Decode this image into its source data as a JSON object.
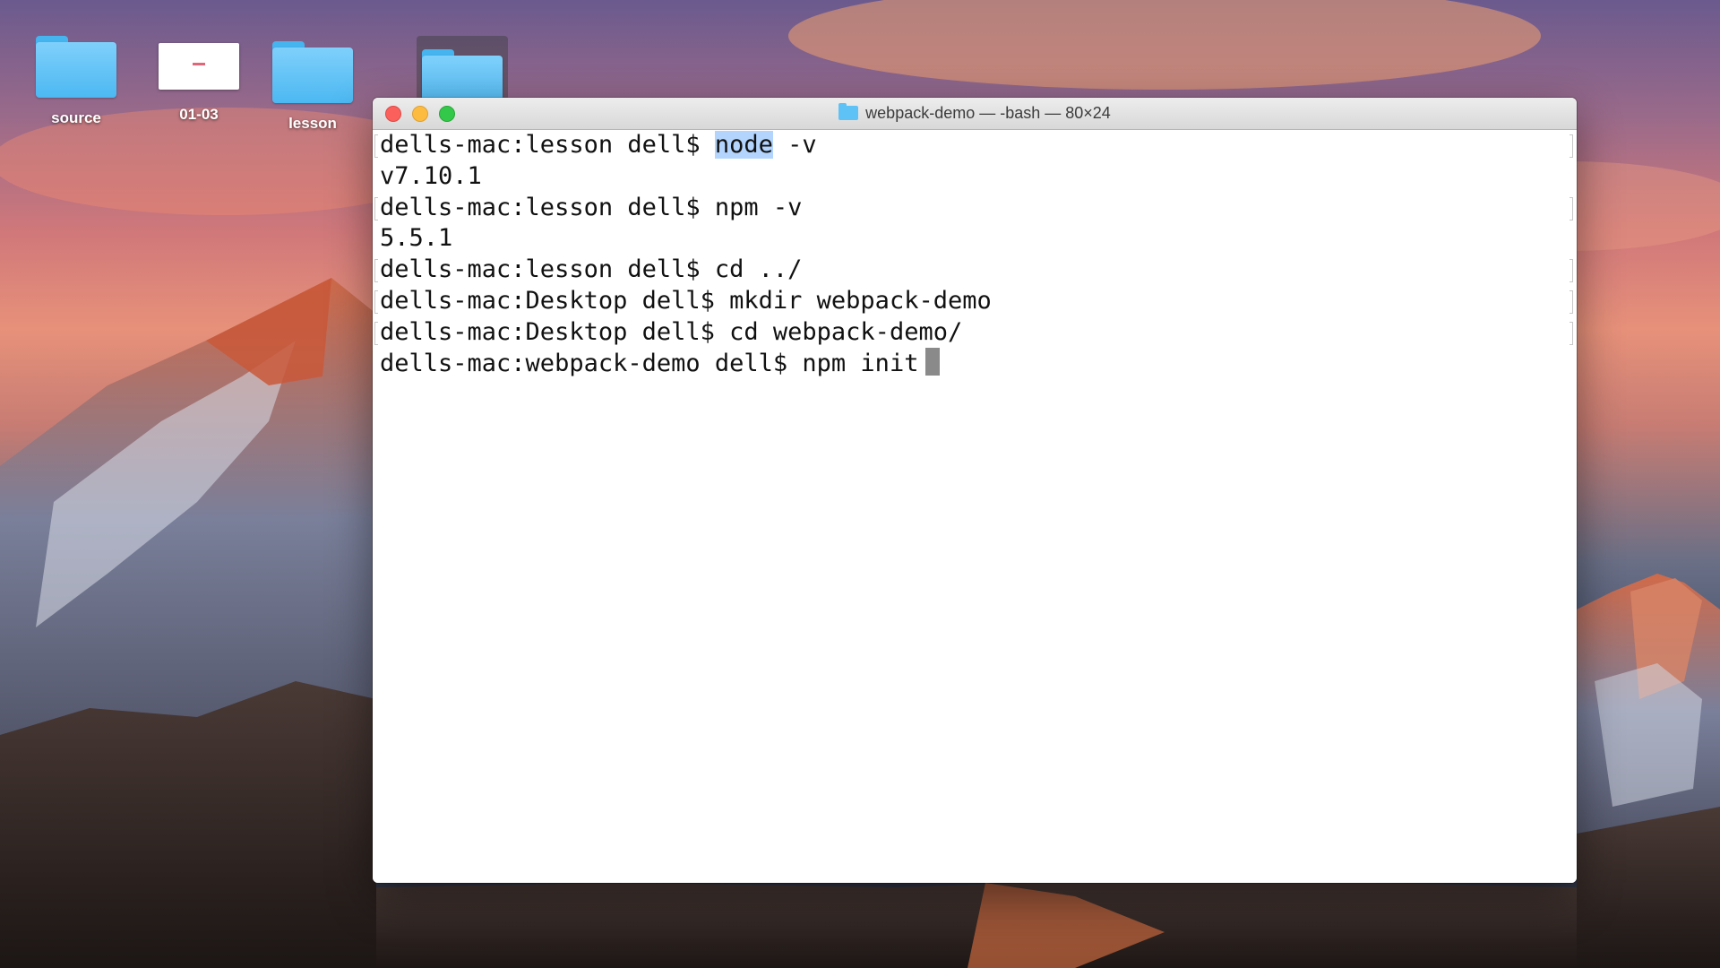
{
  "desktop": {
    "icons": [
      {
        "label": "source",
        "type": "folder"
      },
      {
        "label": "01-03",
        "type": "document"
      },
      {
        "label": "lesson",
        "type": "folder"
      },
      {
        "label": "",
        "type": "folder"
      }
    ]
  },
  "window": {
    "title": "webpack-demo — -bash — 80×24",
    "title_icon": "folder-icon",
    "buttons": {
      "close": "close",
      "minimize": "minimize",
      "maximize": "maximize"
    }
  },
  "terminal": {
    "lines": [
      {
        "prompt": "dells-mac:lesson dell$ ",
        "highlight": "node",
        "rest": " -v"
      },
      {
        "text": "v7.10.1"
      },
      {
        "text": "dells-mac:lesson dell$ npm -v"
      },
      {
        "text": "5.5.1"
      },
      {
        "text": "dells-mac:lesson dell$ cd ../"
      },
      {
        "text": "dells-mac:Desktop dell$ mkdir webpack-demo"
      },
      {
        "text": "dells-mac:Desktop dell$ cd webpack-demo/"
      },
      {
        "text": "dells-mac:webpack-demo dell$ npm init"
      }
    ]
  },
  "colors": {
    "close": "#fc605c",
    "minimize": "#fdbc40",
    "maximize": "#34c84a",
    "selection": "#b3d4fc",
    "folder": "#4cb8f2"
  }
}
